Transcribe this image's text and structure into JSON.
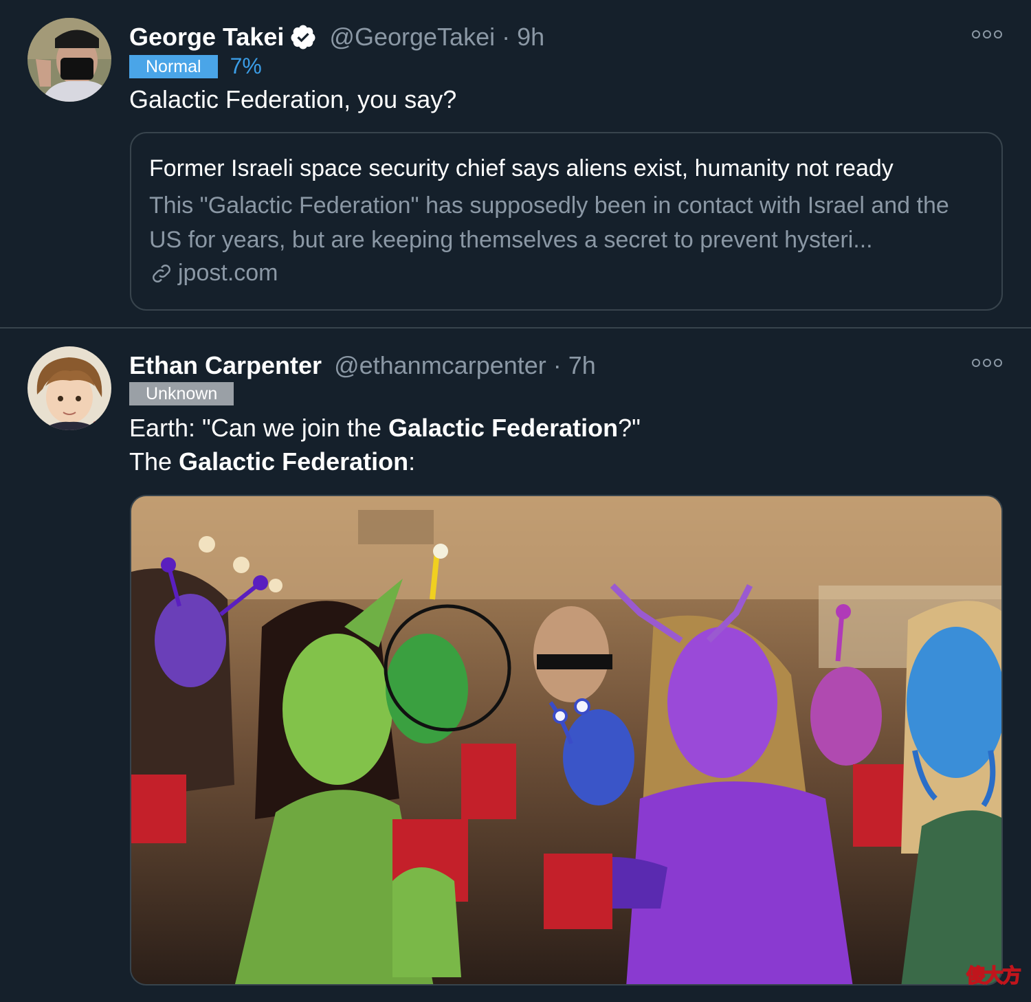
{
  "tweets": [
    {
      "name": "George Takei",
      "handle": "@GeorgeTakei",
      "separator": "·",
      "time": "9h",
      "badge": "Normal",
      "percent": "7%",
      "text": "Galactic Federation, you say?",
      "card": {
        "title": "Former Israeli space security chief says aliens exist, humanity not ready",
        "description": "This \"Galactic Federation\" has supposedly been in contact with Israel and the US for years, but are keeping themselves a secret to prevent hysteri...",
        "domain": "jpost.com"
      }
    },
    {
      "name": "Ethan Carpenter",
      "handle": "@ethanmcarpenter",
      "separator": "·",
      "time": "7h",
      "badge": "Unknown",
      "text_line1_a": "Earth: \"Can we join the ",
      "text_line1_b": "Galactic Federation",
      "text_line1_c": "?\"",
      "text_line2_a": "The ",
      "text_line2_b": "Galactic Federation",
      "text_line2_c": ":"
    }
  ],
  "watermark": "傻大方",
  "colors": {
    "background": "#15202b",
    "border": "#38444d",
    "accent": "#4aa5e8",
    "muted": "#8b98a5"
  }
}
